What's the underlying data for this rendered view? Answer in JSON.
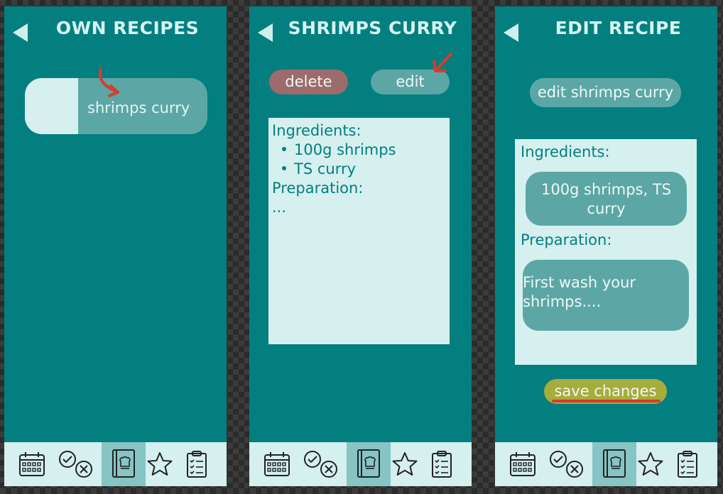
{
  "screens": [
    {
      "title": "OWN RECIPES",
      "recipes": [
        {
          "name": "shrimps curry"
        }
      ],
      "nav": [
        "calendar-icon",
        "check-cross-icon",
        "cookbook-icon",
        "star-icon",
        "clipboard-icon"
      ],
      "active_nav": "cookbook-icon"
    },
    {
      "title": "SHRIMPS CURRY",
      "delete_label": "delete",
      "edit_label": "edit",
      "ingredients_label": "Ingredients:",
      "ingredients": [
        "100g shrimps",
        "TS curry"
      ],
      "preparation_label": "Preparation:",
      "preparation": "...",
      "active_nav": "cookbook-icon"
    },
    {
      "title": "EDIT RECIPE",
      "edit_name_label": "edit shrimps curry",
      "ingredients_label": "Ingredients:",
      "ingredients_line1": "100g shrimps, TS",
      "ingredients_line2": "curry",
      "preparation_label": "Preparation:",
      "preparation_line1": "First wash your",
      "preparation_line2": "shrimps....",
      "save_label": "save changes",
      "active_nav": "cookbook-icon"
    }
  ],
  "colors": {
    "screen_bg": "#037f7f",
    "panel_bg": "#d6efef",
    "pill_bg": "#5ca7a6",
    "delete_bg": "#9d6b6b",
    "save_bg": "#a6ad3d",
    "annotation_red": "#d63c2c"
  }
}
